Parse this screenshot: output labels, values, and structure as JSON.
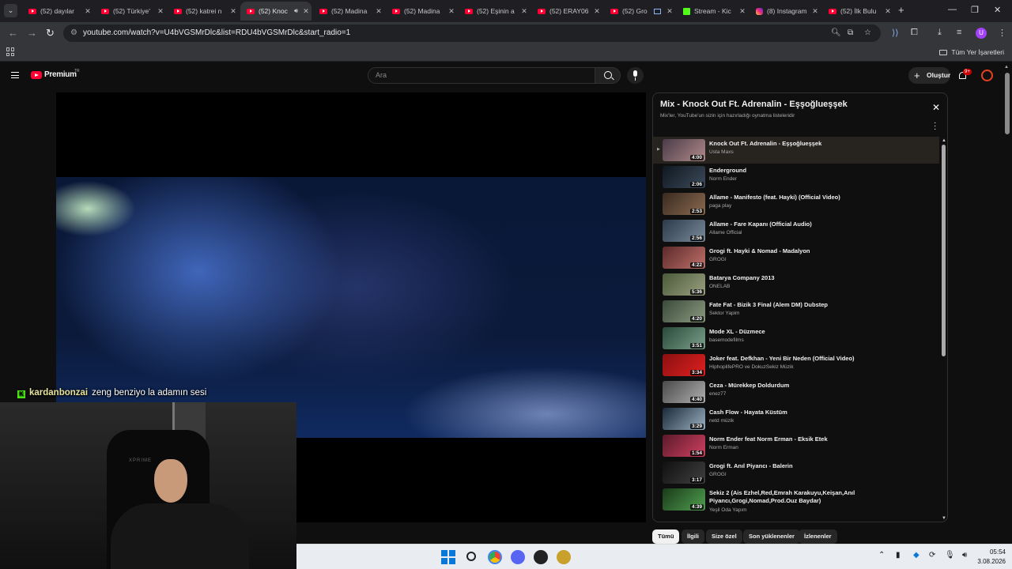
{
  "browser": {
    "tabs": [
      {
        "label": "(52) dayılar",
        "icon": "youtube-icon",
        "active": false
      },
      {
        "label": "(52) Türkiye'",
        "icon": "youtube-icon",
        "active": false
      },
      {
        "label": "(52) katrei n",
        "icon": "youtube-icon",
        "active": false
      },
      {
        "label": "(52) Knoc",
        "icon": "youtube-icon",
        "active": true
      },
      {
        "label": "(52) Madina",
        "icon": "youtube-icon",
        "active": false
      },
      {
        "label": "(52) Madina",
        "icon": "youtube-icon",
        "active": false
      },
      {
        "label": "(52) Eşinin a",
        "icon": "youtube-icon",
        "active": false
      },
      {
        "label": "(52) ERAY06",
        "icon": "youtube-icon",
        "active": false
      },
      {
        "label": "(52) Gro",
        "icon": "youtube-icon",
        "active": false
      },
      {
        "label": "Stream - Kic",
        "icon": "kick-icon",
        "active": false
      },
      {
        "label": "(8) Instagram",
        "icon": "instagram-icon",
        "active": false
      },
      {
        "label": "(52) İlk Bulu",
        "icon": "youtube-icon",
        "active": false
      }
    ],
    "url": "youtube.com/watch?v=U4bVGSMrDlc&list=RDU4bVGSMrDlc&start_radio=1",
    "bookmarks_all": "Tüm Yer İşaretleri",
    "profile_letter": "U"
  },
  "youtube": {
    "logo_text": "Premium",
    "country": "TR",
    "search_placeholder": "Ara",
    "create_label": "Oluştur",
    "notifications_badge": "9+"
  },
  "overlay": {
    "chat_user": "kardanbonzai",
    "chat_message": "zeng benziyo la adamın sesi",
    "chair_brand": "XPRIME"
  },
  "playlist": {
    "title": "Mix - Knock Out Ft. Adrenalin - Eşşoğlueşşek",
    "subtitle": "Mix'ler, YouTube'un sizin için hazırladığı oynatma listeleridir",
    "items": [
      {
        "title": "Knock Out Ft. Adrenalin - Eşşoğlueşşek",
        "channel": "Usta Maxs",
        "duration": "4:00",
        "active": true,
        "thumb": [
          "#4a3b48",
          "#b08a8a"
        ]
      },
      {
        "title": "Enderground",
        "channel": "Norm Ender",
        "duration": "2:06",
        "active": false,
        "thumb": [
          "#101820",
          "#3c4a5a"
        ]
      },
      {
        "title": "Allame - Manifesto (feat. Hayki) (Official Video)",
        "channel": "paga play",
        "duration": "2:53",
        "active": false,
        "thumb": [
          "#3a2a20",
          "#8a6a50"
        ]
      },
      {
        "title": "Allame - Fare Kapanı (Official Audio)",
        "channel": "Allame Official",
        "duration": "2:56",
        "active": false,
        "thumb": [
          "#2a3a4a",
          "#7a8a9a"
        ]
      },
      {
        "title": "Grogi ft. Hayki & Nomad - Madalyon",
        "channel": "GROGI",
        "duration": "4:22",
        "active": false,
        "thumb": [
          "#5a2a2a",
          "#c0706a"
        ]
      },
      {
        "title": "Batarya Company 2013",
        "channel": "ONELAB",
        "duration": "5:36",
        "active": false,
        "thumb": [
          "#4a5a3a",
          "#9aa080"
        ]
      },
      {
        "title": "Fate Fat - Bizik 3 Final (Alem DM) Dubstep",
        "channel": "Sektor Yapim",
        "duration": "4:20",
        "active": false,
        "thumb": [
          "#3a4a3a",
          "#8a9a80"
        ]
      },
      {
        "title": "Mode XL - Düzmece",
        "channel": "basemodefilms",
        "duration": "3:51",
        "active": false,
        "thumb": [
          "#2a4a3a",
          "#7aa08a"
        ]
      },
      {
        "title": "Joker feat. Defkhan - Yeni Bir Neden (Official Video)",
        "channel": "HiphoplifePRO ve DokuzSekiz Müzik",
        "duration": "3:34",
        "active": false,
        "thumb": [
          "#8a1010",
          "#e02020"
        ]
      },
      {
        "title": "Ceza - Mürekkep Doldurdum",
        "channel": "enez77",
        "duration": "4:40",
        "active": false,
        "thumb": [
          "#4a4a4a",
          "#b0b0b0"
        ]
      },
      {
        "title": "Cash Flow - Hayata Küstüm",
        "channel": "netd müzik",
        "duration": "3:29",
        "active": false,
        "thumb": [
          "#1a2a3a",
          "#9ab0c0"
        ]
      },
      {
        "title": "Norm Ender feat Norm Erman - Eksik Etek",
        "channel": "Norm Erman",
        "duration": "1:54",
        "active": false,
        "thumb": [
          "#5a1a2a",
          "#d04060"
        ]
      },
      {
        "title": "Grogi ft. Anıl Piyancı - Balerin",
        "channel": "GROGI",
        "duration": "3:17",
        "active": false,
        "thumb": [
          "#101010",
          "#404040"
        ]
      },
      {
        "title": "Sekiz 2 (Ais Ezhel,Red,Emrah Karakuyu,Keişan,Anıl Piyancı,Grogi,Nomad,Prod.Ouz Baydar)",
        "channel": "Yeşil Oda Yapım",
        "duration": "4:39",
        "active": false,
        "thumb": [
          "#1a3a1a",
          "#50a050"
        ]
      }
    ]
  },
  "chips": [
    "Tümü",
    "İlgili",
    "Size özel",
    "Son yüklenenler",
    "İzlenenler"
  ],
  "taskbar": {
    "time": "05:54",
    "date": "3.08.2026"
  }
}
